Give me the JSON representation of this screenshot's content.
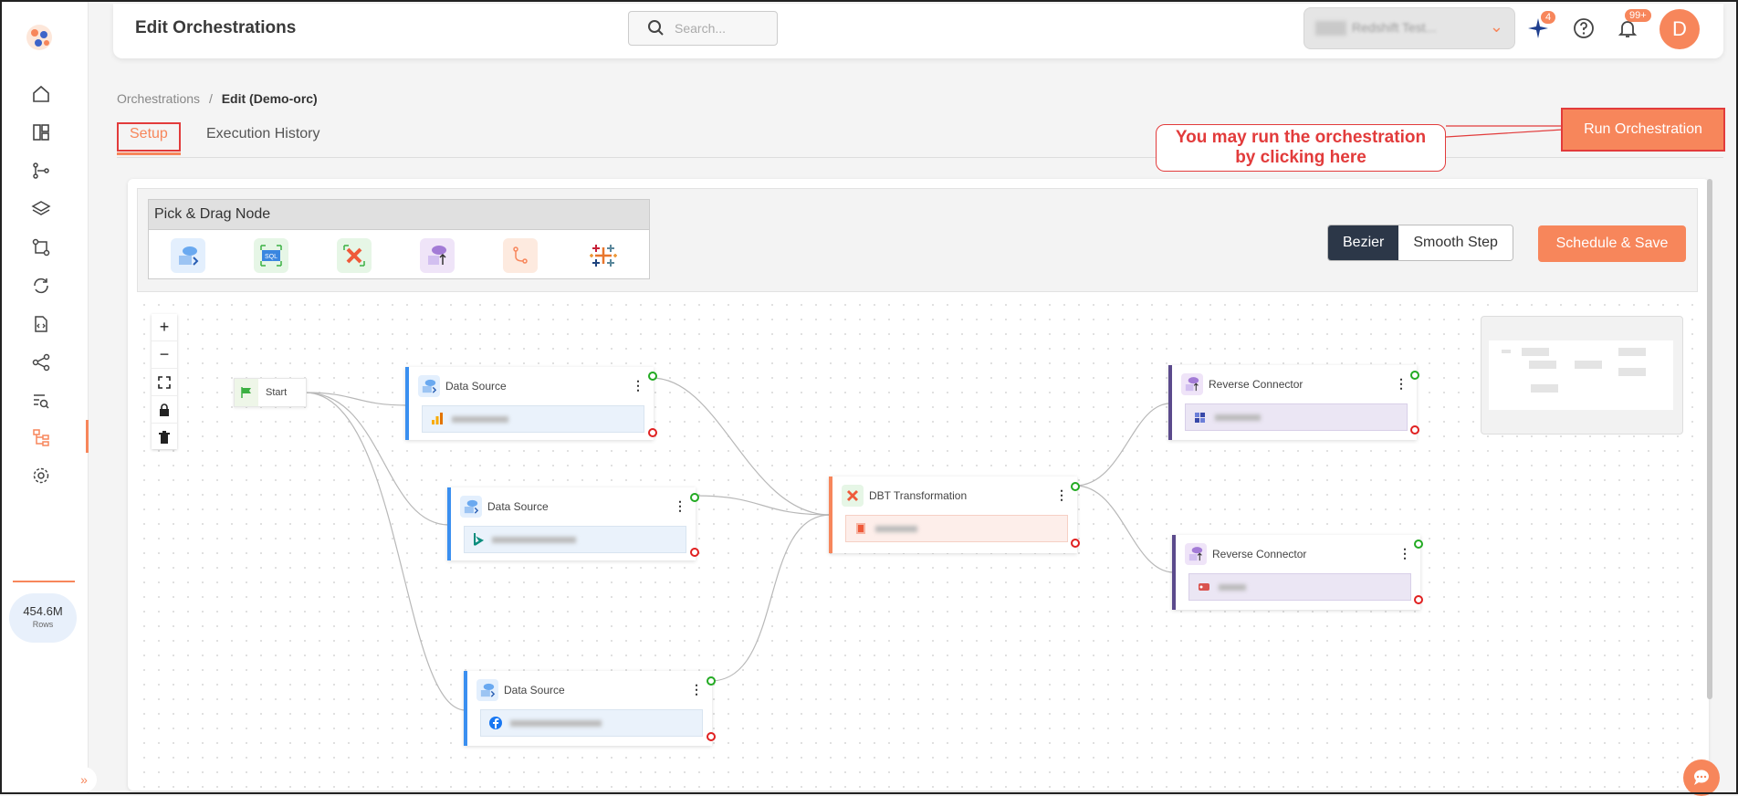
{
  "header": {
    "title": "Edit Orchestrations",
    "search_placeholder": "Search...",
    "notifications_count": "99+",
    "ai_badge_count": "4",
    "avatar_letter": "D",
    "workspace_name": "Redshift Test..."
  },
  "breadcrumb": {
    "parent": "Orchestrations",
    "separator": "/",
    "current": "Edit (Demo-orc)"
  },
  "tabs": [
    {
      "label": "Setup"
    },
    {
      "label": "Execution History"
    }
  ],
  "run_button": {
    "label": "Run Orchestration"
  },
  "callout": {
    "line1": "You may run the orchestration",
    "line2": "by clicking here"
  },
  "palette": {
    "title": "Pick & Drag Node",
    "items": [
      "data-source-icon",
      "sql-icon",
      "dbt-icon",
      "reverse-connector-icon",
      "branch-icon",
      "tableau-icon"
    ]
  },
  "edge_style": {
    "options": [
      "Bezier",
      "Smooth Step"
    ],
    "selected": "Bezier"
  },
  "schedule_button": {
    "label": "Schedule & Save"
  },
  "sidebar": {
    "items": [
      "home-icon",
      "dashboard-icon",
      "pipelines-icon",
      "layers-icon",
      "git-compare-icon",
      "sync-icon",
      "code-file-icon",
      "flow-icon",
      "search-list-icon",
      "orchestration-icon",
      "settings-icon"
    ],
    "active": "orchestration-icon",
    "usage": {
      "value": "454.6M",
      "label": "Rows"
    }
  },
  "flow": {
    "start_label": "Start",
    "nodes": [
      {
        "id": "ds1",
        "title": "Data Source",
        "icon": "google-analytics-icon"
      },
      {
        "id": "ds2",
        "title": "Data Source",
        "icon": "bing-icon"
      },
      {
        "id": "ds3",
        "title": "Data Source",
        "icon": "facebook-icon"
      },
      {
        "id": "dbt",
        "title": "DBT Transformation",
        "icon": "dbt-icon"
      },
      {
        "id": "rc1",
        "title": "Reverse Connector",
        "icon": "reverse-connector-icon"
      },
      {
        "id": "rc2",
        "title": "Reverse Connector",
        "icon": "reverse-connector-icon"
      }
    ]
  },
  "colors": {
    "accent": "#f7865b",
    "annotation": "#e23b3b",
    "dark": "#2c3748",
    "source": "#3a8ff0",
    "transform": "#f7865b",
    "reverse": "#5b4a8c"
  }
}
